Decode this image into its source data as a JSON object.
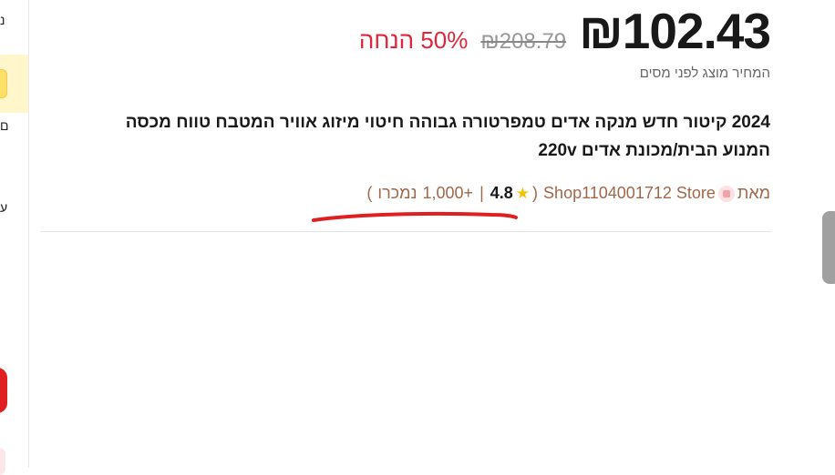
{
  "left_edge": {
    "glyphs": [
      "נ",
      "ם",
      "ע"
    ]
  },
  "price": {
    "current": "₪102.43",
    "original": "₪208.79",
    "discount": "50% הנחה"
  },
  "tax_note": "המחיר מוצג לפני מסים",
  "product": {
    "title": "2024 קיטור חדש מנקה אדים טמפרטורה גבוהה חיטוי מיזוג אוויר המטבח טווח מכסה המנוע הבית/מכונת אדים 220v"
  },
  "seller": {
    "prefix": "מאת",
    "store_name": "Shop1104001712 Store",
    "open_paren": "(",
    "rating": "4.8",
    "separator": "|",
    "sold_count": "1,000+",
    "sold_label": "נמכרו",
    "close_paren": ")",
    "icons": {
      "store": "store-icon",
      "rating": "star-icon"
    }
  },
  "colors": {
    "discount": "#e0263b",
    "seller_text": "#a0684a",
    "annotation": "#e02020",
    "star": "#f5c200"
  }
}
